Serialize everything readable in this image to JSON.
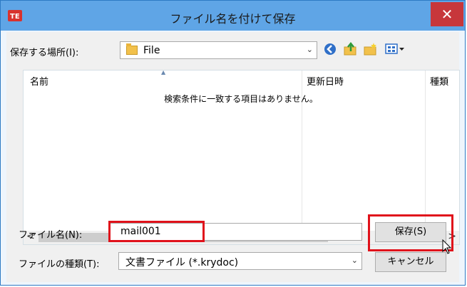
{
  "window": {
    "title": "ファイル名を付けて保存",
    "close_glyph": "✕"
  },
  "location": {
    "label": "保存する場所(I):",
    "value": "File"
  },
  "columns": [
    "名前",
    "更新日時",
    "種類"
  ],
  "list": {
    "empty_message": "検索条件に一致する項目はありません。"
  },
  "filename": {
    "label": "ファイル名(N):",
    "value": "mail001"
  },
  "filetype": {
    "label": "ファイルの種類(T):",
    "value": "文書ファイル (*.krydoc)"
  },
  "buttons": {
    "save": "保存(S)",
    "cancel": "キャンセル"
  },
  "scroll": {
    "left": "<",
    "right": ">"
  },
  "icons": [
    "app-icon",
    "close-icon",
    "folder-icon",
    "back-icon",
    "up-folder-icon",
    "new-folder-icon",
    "view-menu-icon",
    "sort-arrow-icon",
    "dropdown-icon",
    "mouse-cursor-icon"
  ],
  "colors": {
    "titlebar": "#5fa5e6",
    "close": "#c7373b",
    "highlight": "#e0121b"
  }
}
